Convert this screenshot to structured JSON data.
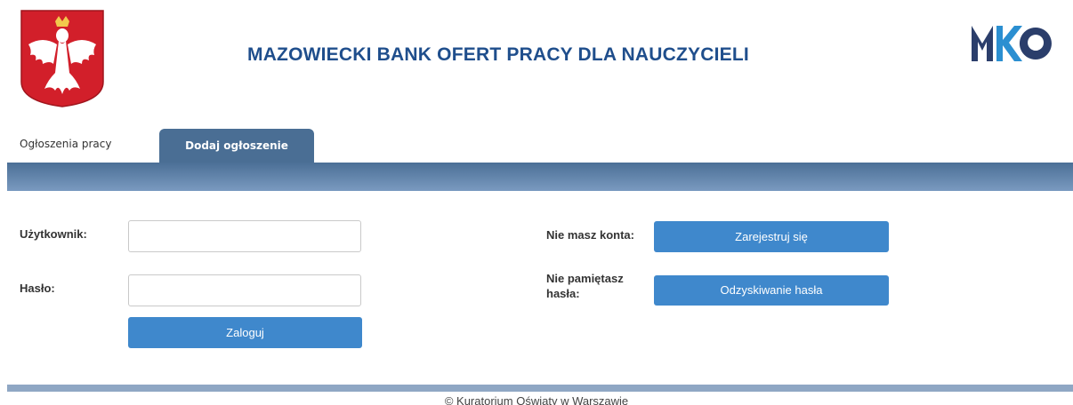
{
  "header": {
    "title": "MAZOWIECKI BANK OFERT PRACY DLA NAUCZYCIELI",
    "logo_left": "polish-eagle-emblem",
    "logo_right": "mko-logo",
    "colors": {
      "title": "#1f4e8c",
      "mko_dark": "#2b3e6b",
      "mko_accent": "#2b8fd1",
      "emblem_red": "#d21f2a"
    }
  },
  "tabs": [
    {
      "label": "Ogłoszenia pracy",
      "active": false
    },
    {
      "label": "Dodaj ogłoszenie",
      "active": true
    }
  ],
  "login": {
    "user_label": "Użytkownik:",
    "user_value": "",
    "password_label": "Hasło:",
    "password_value": "",
    "login_button": "Zaloguj"
  },
  "side": {
    "no_account_label": "Nie masz konta:",
    "register_button": "Zarejestruj się",
    "forgot_label_line1": "Nie pamiętasz",
    "forgot_label_line2": "hasła:",
    "recover_button": "Odzyskiwanie hasła"
  },
  "footer": {
    "text": "© Kuratorium Oświaty w Warszawie"
  },
  "colors": {
    "nav_bar": "#4b6f96",
    "button": "#3f88cc",
    "active_tab": "#4a6e94"
  }
}
